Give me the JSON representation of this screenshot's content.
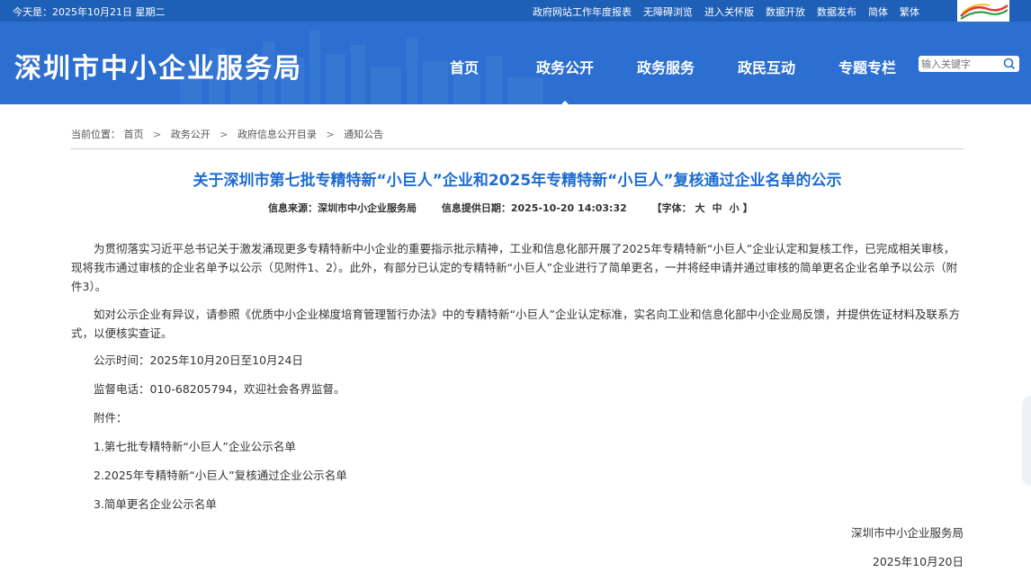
{
  "topbar": {
    "date": "今天是：2025年10月21日 星期二",
    "links": [
      "政府网站工作年度报表",
      "无障碍浏览",
      "进入关怀版",
      "数据开放",
      "数据发布",
      "简体",
      "繁体"
    ],
    "logo_icon": "shenzhen-gov-logo-icon"
  },
  "header": {
    "site_title": "深圳市中小企业服务局",
    "nav": [
      "首页",
      "政务公开",
      "政务服务",
      "政民互动",
      "专题专栏"
    ],
    "active_nav": "政务公开",
    "search_placeholder": "输入关键字",
    "bg_color": "#2c6fd0",
    "topbar_color": "#1e5fb8"
  },
  "breadcrumb": {
    "prefix": "当前位置：",
    "items": [
      "首页",
      "政务公开",
      "政府信息公开目录",
      "通知公告"
    ],
    "separator": ">"
  },
  "article": {
    "title": "关于深圳市第七批专精特新“小巨人”企业和2025年专精特新“小巨人”复核通过企业名单的公示",
    "title_color": "#1e6cd1",
    "source": "信息来源：深圳市中小企业服务局",
    "date": "信息提供日期：2025-10-20 14:03:32",
    "font_size_label": "【字体：",
    "font_sizes": [
      "大",
      "中",
      "小"
    ],
    "font_size_close": "】",
    "paragraphs": [
      "为贯彻落实习近平总书记关于激发涌现更多专精特新中小企业的重要指示批示精神，工业和信息化部开展了2025年专精特新“小巨人”企业认定和复核工作，已完成相关审核，现将我市通过审核的企业名单予以公示（见附件1、2）。此外，有部分已认定的专精特新“小巨人”企业进行了简单更名，一并将经申请并通过审核的简单更名企业名单予以公示（附件3）。",
      "如对公示企业有异议，请参照《优质中小企业梯度培育管理暂行办法》中的专精特新“小巨人”企业认定标准，实名向工业和信息化部中小企业局反馈，并提供佐证材料及联系方式，以便核实查证。"
    ],
    "period": "公示时间：2025年10月20日至10月24日",
    "phone": "监督电话：010-68205794，欢迎社会各界监督。",
    "attachments_label": "附件：",
    "attachments": [
      "1.第七批专精特新“小巨人”企业公示名单",
      "2.2025年专精特新“小巨人”复核通过企业公示名单",
      "3.简单更名企业公示名单"
    ],
    "signature": "深圳市中小企业服务局",
    "sign_date": "2025年10月20日"
  }
}
